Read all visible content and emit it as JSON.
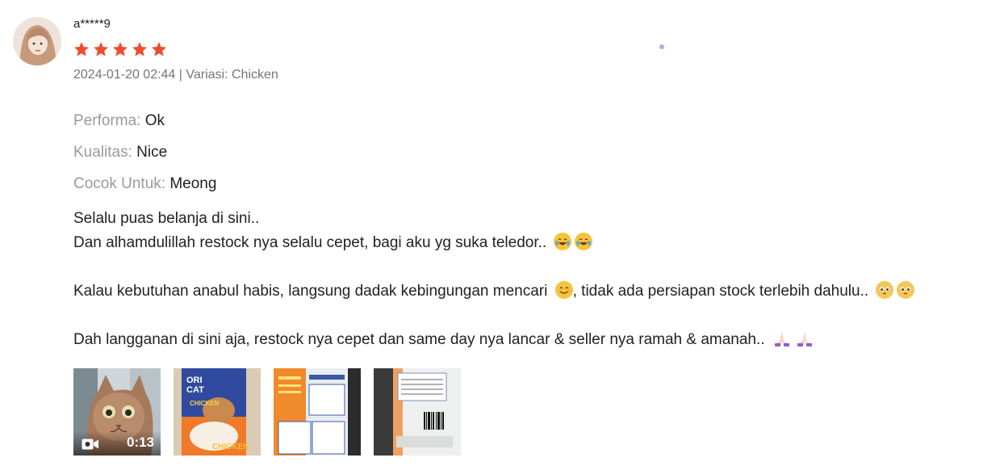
{
  "review": {
    "username": "a*****9",
    "rating": 5,
    "date": "2024-01-20 02:44",
    "variation": "Chicken",
    "meta_separator": " | Variasi: ",
    "attributes": [
      {
        "label": "Performa:",
        "value": "Ok"
      },
      {
        "label": "Kualitas:",
        "value": "Nice"
      },
      {
        "label": "Cocok Untuk:",
        "value": "Meong"
      }
    ],
    "body": {
      "line1": "Selalu puas belanja di sini..",
      "line2": "Dan alhamdulillah restock nya selalu cepet, bagi aku yg suka teledor..",
      "line3a": "Kalau kebutuhan anabul habis, langsung dadak kebingungan mencari",
      "line3b": ", tidak ada persiapan stock terlebih dahulu..",
      "line4": "Dah langganan di sini aja, restock nya cepet dan same day nya lancar & seller nya ramah & amanah.."
    },
    "media": [
      {
        "type": "video",
        "duration": "0:13"
      },
      {
        "type": "image"
      },
      {
        "type": "image"
      },
      {
        "type": "image"
      }
    ]
  },
  "colors": {
    "star": "#ee4d2d",
    "label": "#9a9a9a",
    "meta": "#757575"
  },
  "icons": {
    "star": "star-icon",
    "video": "video-camera-icon"
  }
}
